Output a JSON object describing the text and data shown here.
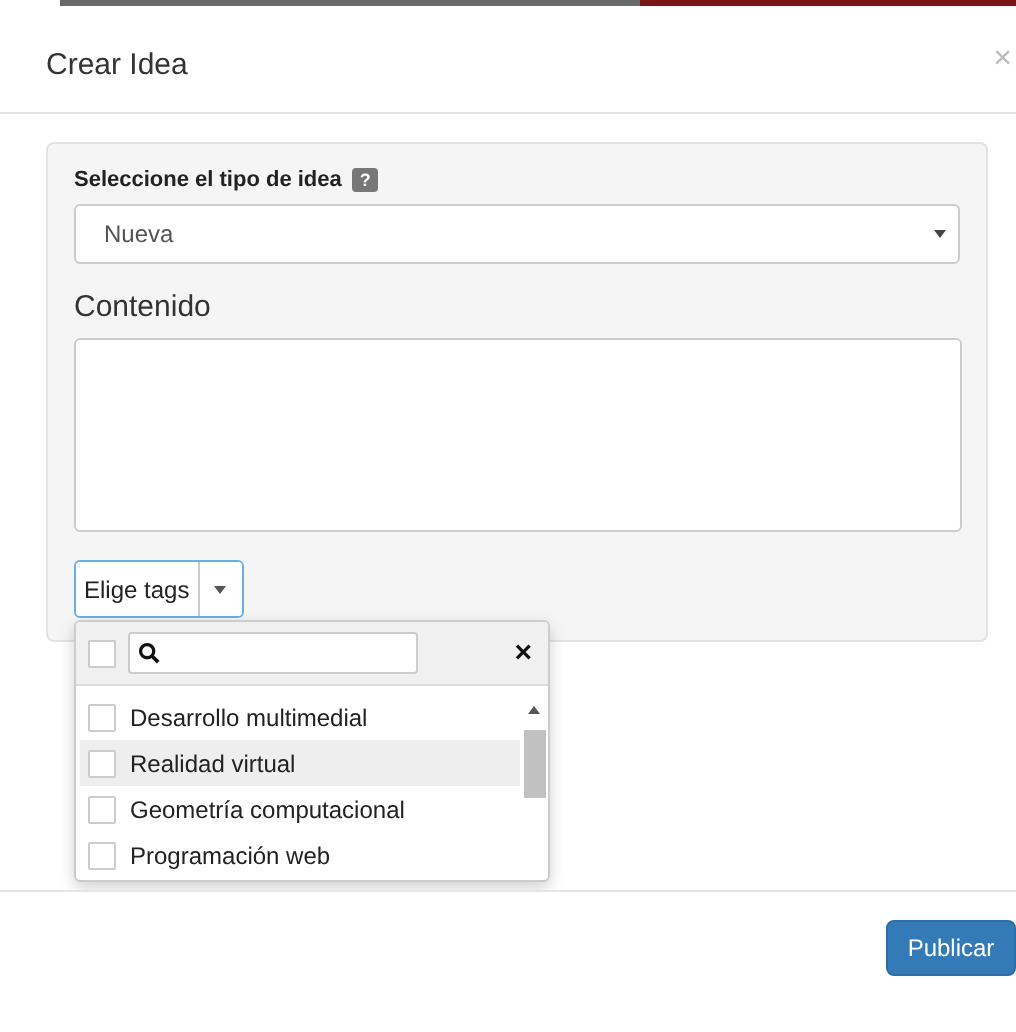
{
  "modal": {
    "title": "Crear Idea",
    "close": "×"
  },
  "form": {
    "type_label": "Seleccione el tipo de idea",
    "help_badge": "?",
    "type_value": "Nueva",
    "content_label": "Contenido"
  },
  "tags": {
    "button": "Elige tags",
    "items": [
      {
        "label": "Desarrollo multimedial",
        "checked": false,
        "highlighted": false
      },
      {
        "label": "Realidad virtual",
        "checked": false,
        "highlighted": true
      },
      {
        "label": "Geometría computacional",
        "checked": false,
        "highlighted": false
      },
      {
        "label": "Programación web",
        "checked": false,
        "highlighted": false
      }
    ],
    "select_all_checked": false,
    "clear": "×"
  },
  "footer": {
    "publish": "Publicar"
  }
}
